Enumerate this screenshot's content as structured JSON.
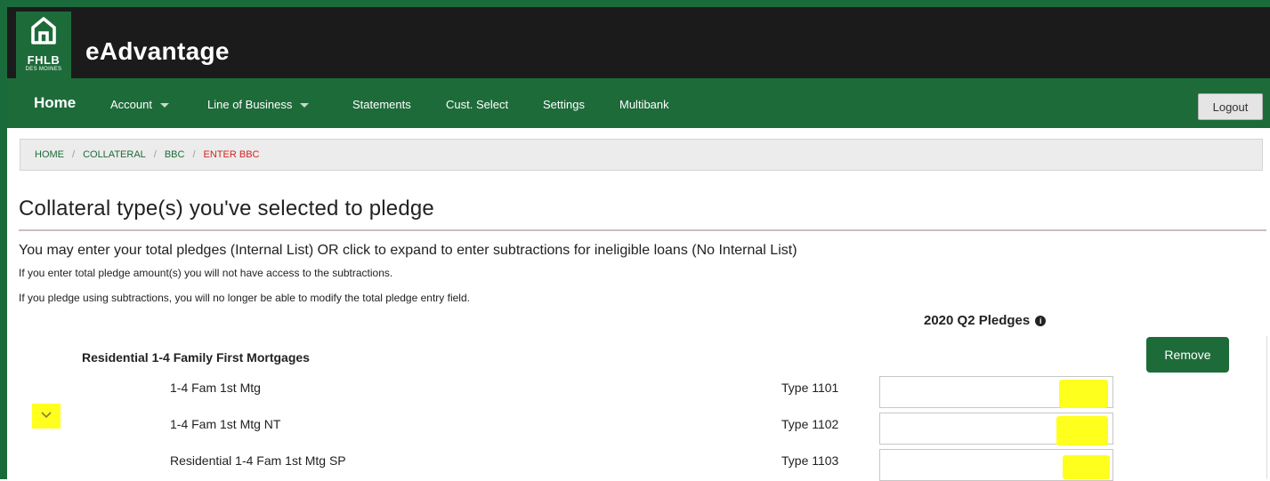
{
  "brand": {
    "logo_text": "FHLB",
    "logo_subtext": "DES MOINES",
    "app_name": "eAdvantage"
  },
  "nav": {
    "home": "Home",
    "account": "Account",
    "line_of_business": "Line of Business",
    "statements": "Statements",
    "cust_select": "Cust. Select",
    "settings": "Settings",
    "multibank": "Multibank",
    "logout": "Logout"
  },
  "breadcrumb": {
    "home": "HOME",
    "collateral": "COLLATERAL",
    "bbc": "BBC",
    "current": "ENTER BBC",
    "separator": "/"
  },
  "page": {
    "title": "Collateral type(s) you've selected to pledge",
    "intro": "You may enter your total pledges (Internal List) OR click to expand to enter subtractions for ineligible loans (No Internal List)",
    "note_1": "If you enter total pledge amount(s) you will not have access to the subtractions.",
    "note_2": "If you pledge using subtractions, you will no longer be able to modify the total pledge entry field.",
    "pledges_header": "2020 Q2 Pledges"
  },
  "group": {
    "title": "Residential 1-4 Family First Mortgages",
    "remove_label": "Remove",
    "rows": [
      {
        "label": "1-4 Fam 1st Mtg",
        "type": "Type 1101",
        "amount": ""
      },
      {
        "label": "1-4 Fam 1st Mtg NT",
        "type": "Type 1102",
        "amount": ""
      },
      {
        "label": "Residential 1-4 Fam 1st Mtg SP",
        "type": "Type 1103",
        "amount": ""
      }
    ]
  },
  "colors": {
    "brand_green": "#1e6b3a",
    "header_black": "#1b1b1b",
    "breadcrumb_active": "#d42424",
    "highlight": "#ffff1e"
  },
  "icons": {
    "logo": "house-icon",
    "info": "info-icon",
    "expand": "chevron-down-icon",
    "dropdown": "caret-down-icon"
  }
}
